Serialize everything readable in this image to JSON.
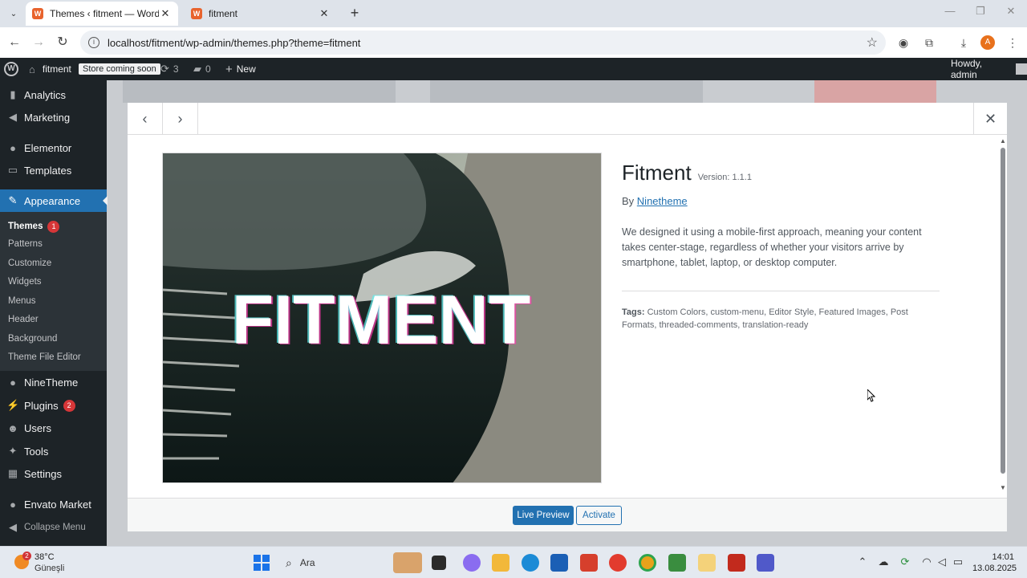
{
  "browser": {
    "tabs": [
      {
        "title": "Themes ‹ fitment — WordPress",
        "active": true
      },
      {
        "title": "fitment",
        "active": false
      }
    ],
    "url": "localhost/fitment/wp-admin/themes.php?theme=fitment",
    "profile_initial": "A"
  },
  "adminbar": {
    "site_name": "fitment",
    "store_badge": "Store coming soon",
    "updates_count": "3",
    "comments_count": "0",
    "new_label": "New",
    "howdy": "Howdy, admin"
  },
  "sidebar": {
    "items": [
      {
        "label": "Analytics",
        "icon": "analytics-icon"
      },
      {
        "label": "Marketing",
        "icon": "megaphone-icon"
      },
      {
        "label": "Elementor",
        "icon": "elementor-icon"
      },
      {
        "label": "Templates",
        "icon": "folder-icon"
      },
      {
        "label": "Appearance",
        "icon": "paintbrush-icon"
      },
      {
        "label": "NineTheme",
        "icon": "circle-icon"
      },
      {
        "label": "Plugins",
        "icon": "plug-icon",
        "badge": "2"
      },
      {
        "label": "Users",
        "icon": "user-icon"
      },
      {
        "label": "Tools",
        "icon": "wrench-icon"
      },
      {
        "label": "Settings",
        "icon": "settings-icon"
      },
      {
        "label": "Envato Market",
        "icon": "leaf-icon"
      },
      {
        "label": "Collapse Menu",
        "icon": "collapse-icon"
      }
    ],
    "submenu": [
      {
        "label": "Themes",
        "badge": "1"
      },
      {
        "label": "Patterns"
      },
      {
        "label": "Customize"
      },
      {
        "label": "Widgets"
      },
      {
        "label": "Menus"
      },
      {
        "label": "Header"
      },
      {
        "label": "Background"
      },
      {
        "label": "Theme File Editor"
      }
    ]
  },
  "theme": {
    "name": "Fitment",
    "version": "Version: 1.1.1",
    "by": "By",
    "author": "Ninetheme",
    "screenshot_text": "FITMENT",
    "description": "We designed it using a mobile-first approach, meaning your content takes center-stage, regardless of whether your visitors arrive by smartphone, tablet, laptop, or desktop computer.",
    "tags_label": "Tags:",
    "tags": "Custom Colors, custom-menu, Editor Style, Featured Images, Post Formats, threaded-comments, translation-ready"
  },
  "buttons": {
    "live_preview": "Live Preview",
    "activate": "Activate"
  },
  "taskbar": {
    "temperature": "38°C",
    "weather_desc": "Güneşli",
    "weather_badge": "2",
    "search_placeholder": "Ara",
    "time": "14:01",
    "date": "13.08.2025"
  },
  "colors": {
    "wp_blue": "#2271b1",
    "admin_dark": "#1d2327",
    "badge_red": "#d63638"
  }
}
